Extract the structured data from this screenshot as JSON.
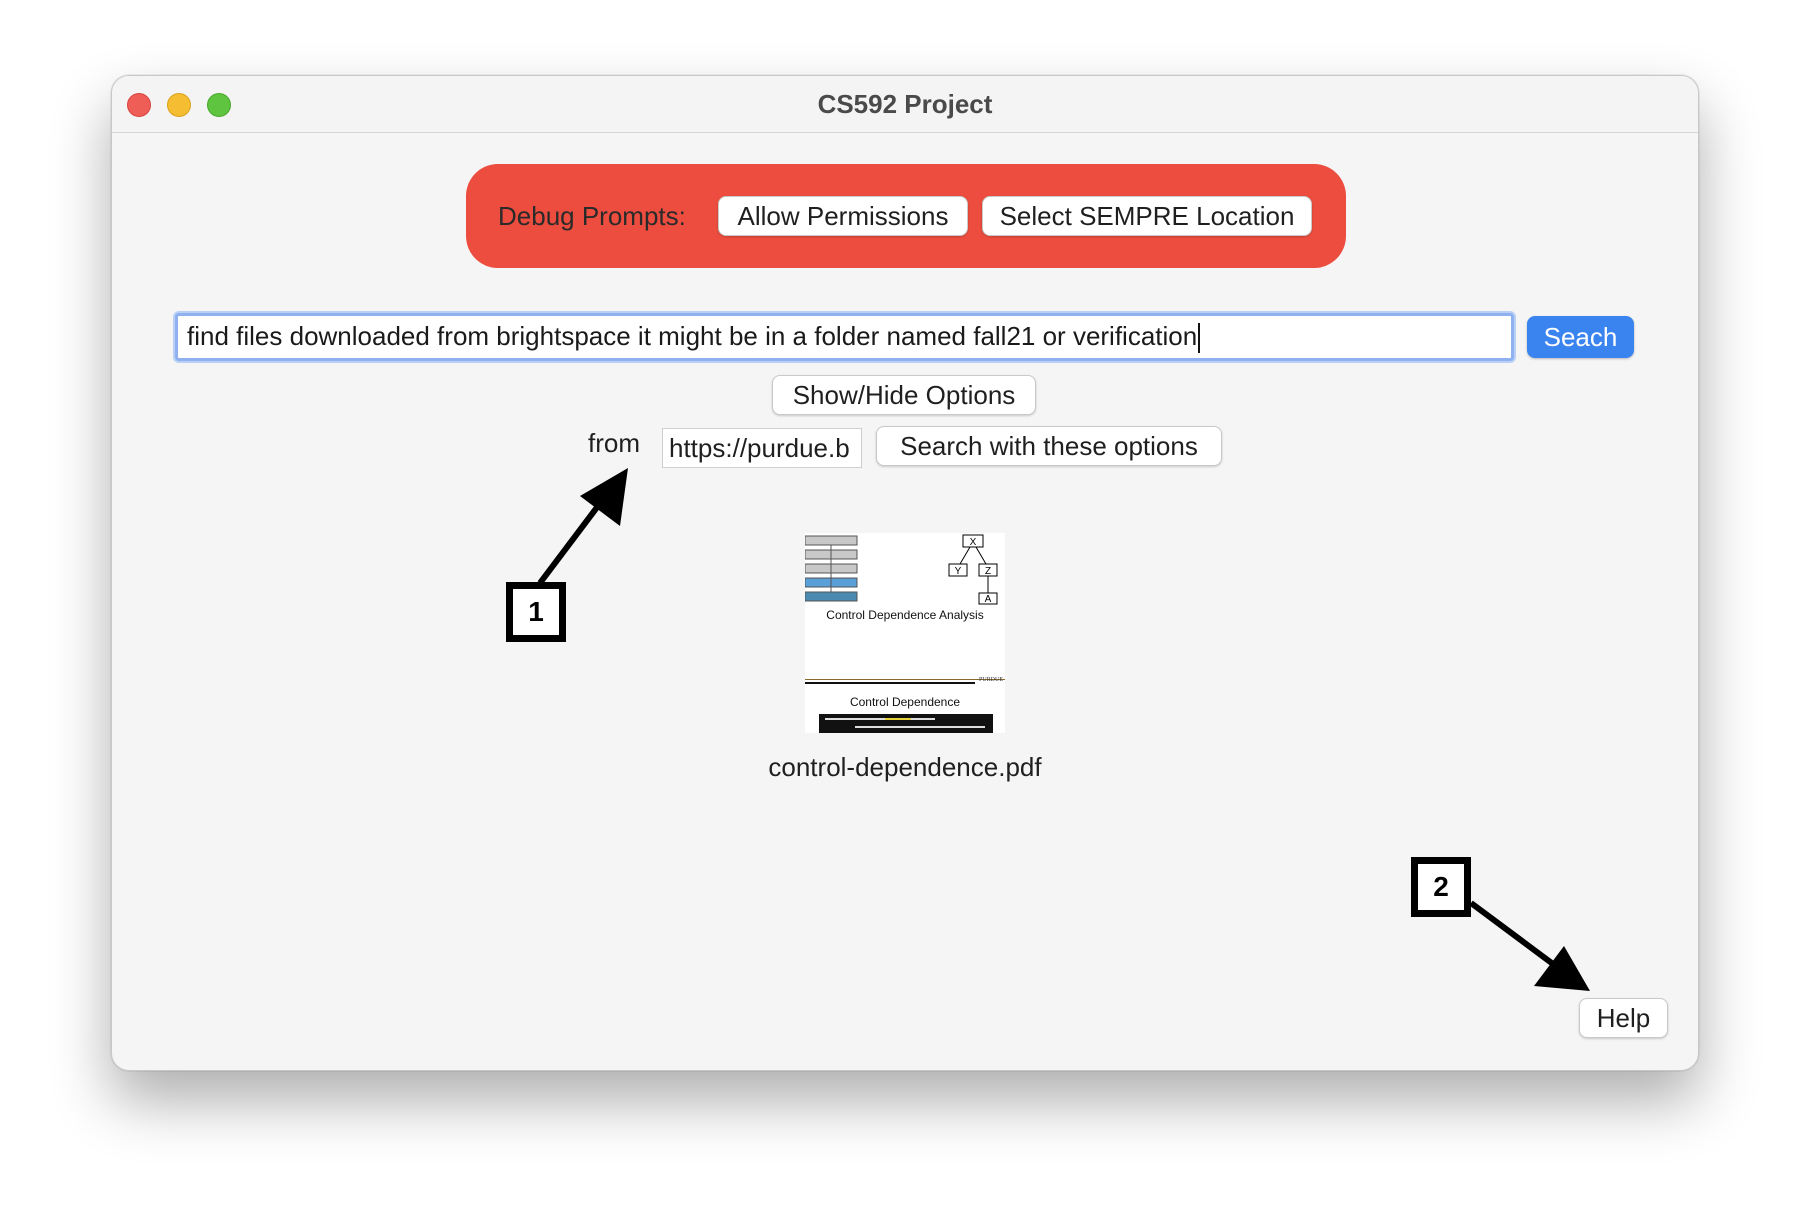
{
  "window": {
    "title": "CS592 Project"
  },
  "debug": {
    "label": "Debug Prompts:",
    "allow_label": "Allow Permissions",
    "sempre_label": "Select SEMPRE Location",
    "color": "#ec4d3e"
  },
  "search": {
    "query": "find files downloaded from brightspace it might be in a folder named fall21 or verification",
    "button_label": "Seach",
    "button_color": "#3a84f0"
  },
  "options": {
    "toggle_label": "Show/Hide Options",
    "from_label": "from",
    "from_value": "https://purdue.b",
    "search_with_options_label": "Search with these options"
  },
  "results": [
    {
      "file_name": "control-dependence.pdf",
      "thumbnail": {
        "top_heading": "Control Dependence Analysis",
        "bottom_heading": "Control Dependence",
        "footer_brand": "PURDUE",
        "graph_nodes": [
          "X",
          "Y",
          "Z",
          "A"
        ]
      }
    }
  ],
  "help": {
    "label": "Help"
  },
  "annotations": [
    {
      "number": "1"
    },
    {
      "number": "2"
    }
  ]
}
